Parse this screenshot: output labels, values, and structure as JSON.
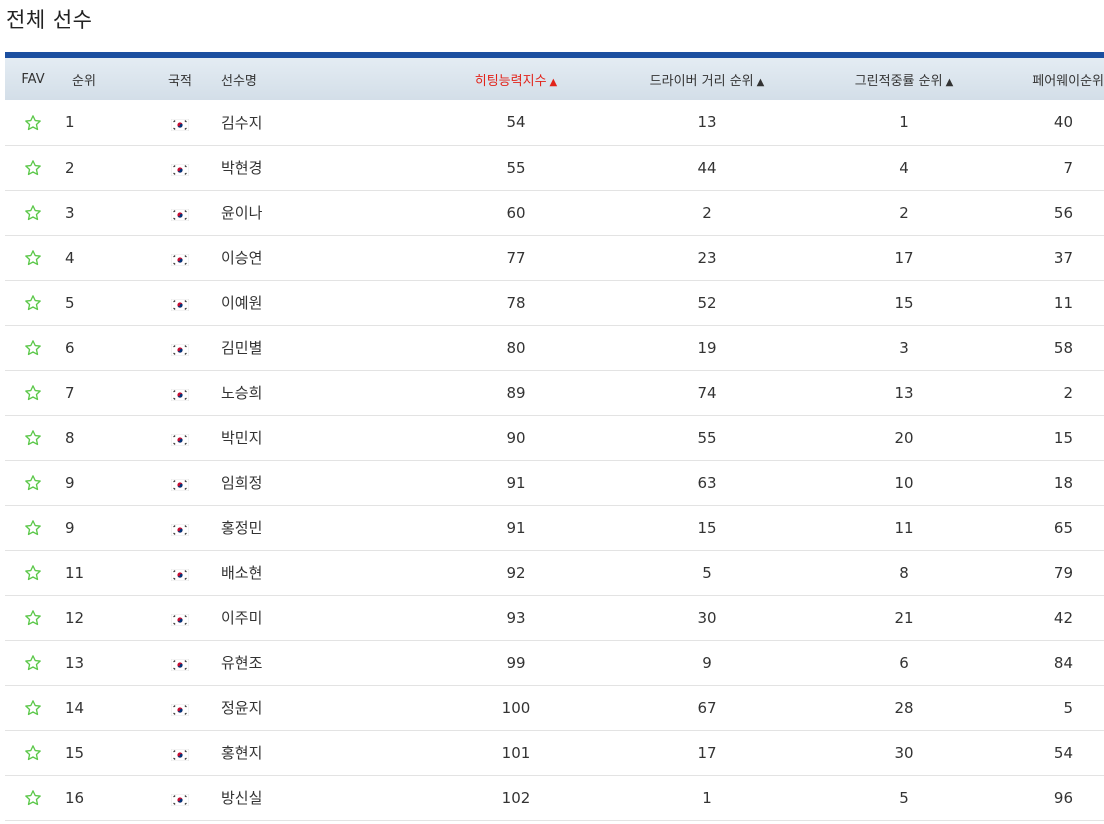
{
  "page": {
    "title": "전체 선수"
  },
  "table": {
    "headers": {
      "fav": "FAV",
      "rank": "순위",
      "nationality": "국적",
      "name": "선수명",
      "hitting": "히팅능력지수",
      "driver": "드라이버 거리 순위",
      "green": "그린적중률 순위",
      "fairway": "페어웨이순위"
    },
    "sort_arrow": "▲",
    "sorted_column": "hitting",
    "colors": {
      "header_bar": "#1b4fa0",
      "sorted": "#e2231a",
      "fav_star": "#5cc84a"
    },
    "fav_icon": "star-outline-icon",
    "flag_icon": "korea-flag-icon",
    "rows": [
      {
        "rank": "1",
        "name": "김수지",
        "hitting": "54",
        "driver": "13",
        "green": "1",
        "fairway": "40"
      },
      {
        "rank": "2",
        "name": "박현경",
        "hitting": "55",
        "driver": "44",
        "green": "4",
        "fairway": "7"
      },
      {
        "rank": "3",
        "name": "윤이나",
        "hitting": "60",
        "driver": "2",
        "green": "2",
        "fairway": "56"
      },
      {
        "rank": "4",
        "name": "이승연",
        "hitting": "77",
        "driver": "23",
        "green": "17",
        "fairway": "37"
      },
      {
        "rank": "5",
        "name": "이예원",
        "hitting": "78",
        "driver": "52",
        "green": "15",
        "fairway": "11"
      },
      {
        "rank": "6",
        "name": "김민별",
        "hitting": "80",
        "driver": "19",
        "green": "3",
        "fairway": "58"
      },
      {
        "rank": "7",
        "name": "노승희",
        "hitting": "89",
        "driver": "74",
        "green": "13",
        "fairway": "2"
      },
      {
        "rank": "8",
        "name": "박민지",
        "hitting": "90",
        "driver": "55",
        "green": "20",
        "fairway": "15"
      },
      {
        "rank": "9",
        "name": "임희정",
        "hitting": "91",
        "driver": "63",
        "green": "10",
        "fairway": "18"
      },
      {
        "rank": "9",
        "name": "홍정민",
        "hitting": "91",
        "driver": "15",
        "green": "11",
        "fairway": "65"
      },
      {
        "rank": "11",
        "name": "배소현",
        "hitting": "92",
        "driver": "5",
        "green": "8",
        "fairway": "79"
      },
      {
        "rank": "12",
        "name": "이주미",
        "hitting": "93",
        "driver": "30",
        "green": "21",
        "fairway": "42"
      },
      {
        "rank": "13",
        "name": "유현조",
        "hitting": "99",
        "driver": "9",
        "green": "6",
        "fairway": "84"
      },
      {
        "rank": "14",
        "name": "정윤지",
        "hitting": "100",
        "driver": "67",
        "green": "28",
        "fairway": "5"
      },
      {
        "rank": "15",
        "name": "홍현지",
        "hitting": "101",
        "driver": "17",
        "green": "30",
        "fairway": "54"
      },
      {
        "rank": "16",
        "name": "방신실",
        "hitting": "102",
        "driver": "1",
        "green": "5",
        "fairway": "96"
      }
    ]
  }
}
